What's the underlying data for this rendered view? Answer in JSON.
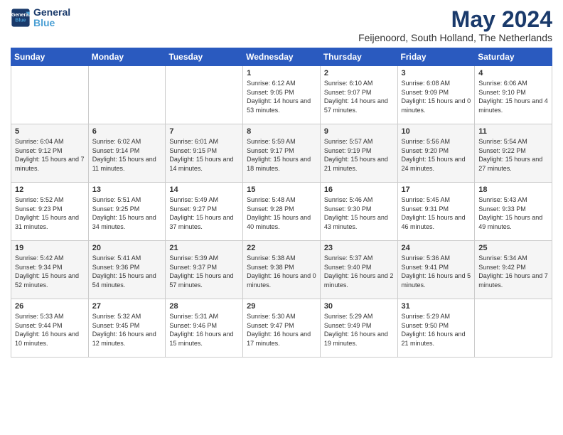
{
  "logo": {
    "line1": "General",
    "line2": "Blue"
  },
  "title": "May 2024",
  "location": "Feijenoord, South Holland, The Netherlands",
  "days_of_week": [
    "Sunday",
    "Monday",
    "Tuesday",
    "Wednesday",
    "Thursday",
    "Friday",
    "Saturday"
  ],
  "weeks": [
    [
      {
        "day": "",
        "info": ""
      },
      {
        "day": "",
        "info": ""
      },
      {
        "day": "",
        "info": ""
      },
      {
        "day": "1",
        "info": "Sunrise: 6:12 AM\nSunset: 9:05 PM\nDaylight: 14 hours and 53 minutes."
      },
      {
        "day": "2",
        "info": "Sunrise: 6:10 AM\nSunset: 9:07 PM\nDaylight: 14 hours and 57 minutes."
      },
      {
        "day": "3",
        "info": "Sunrise: 6:08 AM\nSunset: 9:09 PM\nDaylight: 15 hours and 0 minutes."
      },
      {
        "day": "4",
        "info": "Sunrise: 6:06 AM\nSunset: 9:10 PM\nDaylight: 15 hours and 4 minutes."
      }
    ],
    [
      {
        "day": "5",
        "info": "Sunrise: 6:04 AM\nSunset: 9:12 PM\nDaylight: 15 hours and 7 minutes."
      },
      {
        "day": "6",
        "info": "Sunrise: 6:02 AM\nSunset: 9:14 PM\nDaylight: 15 hours and 11 minutes."
      },
      {
        "day": "7",
        "info": "Sunrise: 6:01 AM\nSunset: 9:15 PM\nDaylight: 15 hours and 14 minutes."
      },
      {
        "day": "8",
        "info": "Sunrise: 5:59 AM\nSunset: 9:17 PM\nDaylight: 15 hours and 18 minutes."
      },
      {
        "day": "9",
        "info": "Sunrise: 5:57 AM\nSunset: 9:19 PM\nDaylight: 15 hours and 21 minutes."
      },
      {
        "day": "10",
        "info": "Sunrise: 5:56 AM\nSunset: 9:20 PM\nDaylight: 15 hours and 24 minutes."
      },
      {
        "day": "11",
        "info": "Sunrise: 5:54 AM\nSunset: 9:22 PM\nDaylight: 15 hours and 27 minutes."
      }
    ],
    [
      {
        "day": "12",
        "info": "Sunrise: 5:52 AM\nSunset: 9:23 PM\nDaylight: 15 hours and 31 minutes."
      },
      {
        "day": "13",
        "info": "Sunrise: 5:51 AM\nSunset: 9:25 PM\nDaylight: 15 hours and 34 minutes."
      },
      {
        "day": "14",
        "info": "Sunrise: 5:49 AM\nSunset: 9:27 PM\nDaylight: 15 hours and 37 minutes."
      },
      {
        "day": "15",
        "info": "Sunrise: 5:48 AM\nSunset: 9:28 PM\nDaylight: 15 hours and 40 minutes."
      },
      {
        "day": "16",
        "info": "Sunrise: 5:46 AM\nSunset: 9:30 PM\nDaylight: 15 hours and 43 minutes."
      },
      {
        "day": "17",
        "info": "Sunrise: 5:45 AM\nSunset: 9:31 PM\nDaylight: 15 hours and 46 minutes."
      },
      {
        "day": "18",
        "info": "Sunrise: 5:43 AM\nSunset: 9:33 PM\nDaylight: 15 hours and 49 minutes."
      }
    ],
    [
      {
        "day": "19",
        "info": "Sunrise: 5:42 AM\nSunset: 9:34 PM\nDaylight: 15 hours and 52 minutes."
      },
      {
        "day": "20",
        "info": "Sunrise: 5:41 AM\nSunset: 9:36 PM\nDaylight: 15 hours and 54 minutes."
      },
      {
        "day": "21",
        "info": "Sunrise: 5:39 AM\nSunset: 9:37 PM\nDaylight: 15 hours and 57 minutes."
      },
      {
        "day": "22",
        "info": "Sunrise: 5:38 AM\nSunset: 9:38 PM\nDaylight: 16 hours and 0 minutes."
      },
      {
        "day": "23",
        "info": "Sunrise: 5:37 AM\nSunset: 9:40 PM\nDaylight: 16 hours and 2 minutes."
      },
      {
        "day": "24",
        "info": "Sunrise: 5:36 AM\nSunset: 9:41 PM\nDaylight: 16 hours and 5 minutes."
      },
      {
        "day": "25",
        "info": "Sunrise: 5:34 AM\nSunset: 9:42 PM\nDaylight: 16 hours and 7 minutes."
      }
    ],
    [
      {
        "day": "26",
        "info": "Sunrise: 5:33 AM\nSunset: 9:44 PM\nDaylight: 16 hours and 10 minutes."
      },
      {
        "day": "27",
        "info": "Sunrise: 5:32 AM\nSunset: 9:45 PM\nDaylight: 16 hours and 12 minutes."
      },
      {
        "day": "28",
        "info": "Sunrise: 5:31 AM\nSunset: 9:46 PM\nDaylight: 16 hours and 15 minutes."
      },
      {
        "day": "29",
        "info": "Sunrise: 5:30 AM\nSunset: 9:47 PM\nDaylight: 16 hours and 17 minutes."
      },
      {
        "day": "30",
        "info": "Sunrise: 5:29 AM\nSunset: 9:49 PM\nDaylight: 16 hours and 19 minutes."
      },
      {
        "day": "31",
        "info": "Sunrise: 5:29 AM\nSunset: 9:50 PM\nDaylight: 16 hours and 21 minutes."
      },
      {
        "day": "",
        "info": ""
      }
    ]
  ]
}
